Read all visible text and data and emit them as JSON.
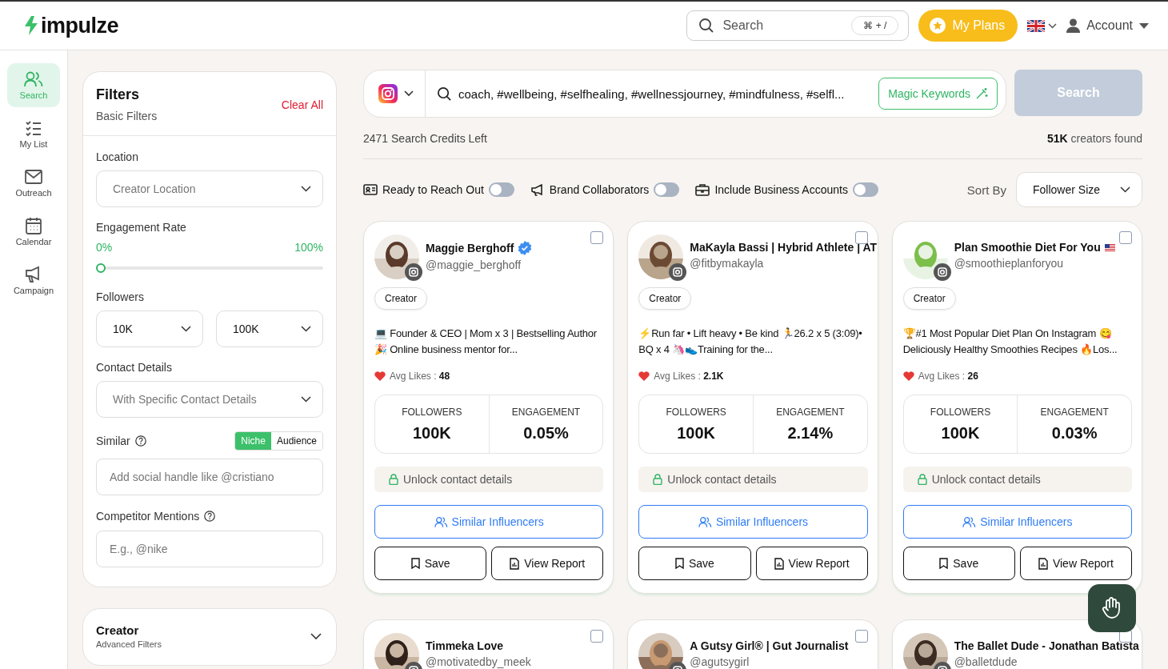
{
  "header": {
    "logo": "impulze",
    "search": {
      "placeholder": "Search",
      "shortcut": "⌘ + /"
    },
    "plans_button": "My Plans",
    "account": "Account"
  },
  "sidebar": {
    "items": [
      {
        "kind": "search",
        "label": "Search",
        "selected": true
      },
      {
        "kind": "list",
        "label": "My List",
        "selected": false
      },
      {
        "kind": "mail",
        "label": "Outreach",
        "selected": false
      },
      {
        "kind": "calendar",
        "label": "Calendar",
        "selected": false
      },
      {
        "kind": "campaign",
        "label": "Campaign",
        "selected": false
      }
    ]
  },
  "filters": {
    "title": "Filters",
    "subtitle": "Basic Filters",
    "clear": "Clear All",
    "location": {
      "label": "Location",
      "placeholder": "Creator Location"
    },
    "engagement": {
      "label": "Engagement Rate",
      "min": "0%",
      "max": "100%",
      "level": 0
    },
    "followers": {
      "label": "Followers",
      "from": "10K",
      "to": "100K"
    },
    "contact": {
      "label": "Contact Details",
      "placeholder": "With Specific Contact Details"
    },
    "similar": {
      "label": "Similar",
      "options": [
        {
          "label": "Niche",
          "selected": true
        },
        {
          "label": "Audience",
          "selected": false
        }
      ],
      "placeholder": "Add social handle like @cristiano"
    },
    "competitor": {
      "label": "Competitor Mentions",
      "placeholder": "E.g., @nike"
    },
    "advanced": {
      "title": "Creator",
      "subtitle": "Advanced Filters"
    }
  },
  "search_bar": {
    "query": "coach, #wellbeing, #selfhealing, #wellnessjourney, #mindfulness, #selfl...",
    "magic": "Magic Keywords",
    "button": "Search"
  },
  "credits": "2471 Search Credits Left",
  "found": {
    "count": "51K",
    "label": "creators found"
  },
  "toggles": [
    {
      "kind": "card",
      "label": "Ready to Reach Out",
      "on": false
    },
    {
      "kind": "megaphone",
      "label": "Brand Collaborators",
      "on": false
    },
    {
      "kind": "briefcase",
      "label": "Include Business Accounts",
      "on": false
    }
  ],
  "sort": {
    "label": "Sort By",
    "value": "Follower Size"
  },
  "cards": [
    {
      "name": "Maggie Berghoff",
      "verified": true,
      "us_flag": false,
      "handle": "@maggie_berghoff",
      "checked": false,
      "tag": "Creator",
      "bio": "💻 Founder & CEO | Mom x 3 | Bestselling Author 🎉 Online business mentor for...",
      "likes_label": "Avg Likes :",
      "likes": "48",
      "followers_label": "FOLLOWERS",
      "followers": "100K",
      "engagement_label": "ENGAGEMENT",
      "engagement": "0.05%",
      "unlock": "Unlock contact details",
      "similar": "Similar Influencers",
      "save": "Save",
      "report": "View Report"
    },
    {
      "name": "MaKayla Bassi | Hybrid Athlete | AT",
      "verified": false,
      "us_flag": false,
      "handle": "@fitbymakayla",
      "checked": false,
      "tag": "Creator",
      "bio": "⚡Run far • Lift heavy • Be kind 🏃26.2 x 5 (3:09)• BQ x 4 🦄👟Training for the...",
      "likes_label": "Avg Likes :",
      "likes": "2.1K",
      "followers_label": "FOLLOWERS",
      "followers": "100K",
      "engagement_label": "ENGAGEMENT",
      "engagement": "2.14%",
      "unlock": "Unlock contact details",
      "similar": "Similar Influencers",
      "save": "Save",
      "report": "View Report"
    },
    {
      "name": "Plan Smoothie Diet For You",
      "verified": false,
      "us_flag": true,
      "handle": "@smoothieplanforyou",
      "checked": false,
      "tag": "Creator",
      "bio": "🏆#1 Most Popular Diet Plan On Instagram 😋 Deliciously Healthy Smoothies Recipes 🔥Los...",
      "likes_label": "Avg Likes :",
      "likes": "26",
      "followers_label": "FOLLOWERS",
      "followers": "100K",
      "engagement_label": "ENGAGEMENT",
      "engagement": "0.03%",
      "unlock": "Unlock contact details",
      "similar": "Similar Influencers",
      "save": "Save",
      "report": "View Report"
    },
    {
      "name": "Timmeka Love",
      "verified": false,
      "us_flag": false,
      "handle": "@motivatedby_meek",
      "checked": false
    },
    {
      "name": "A Gutsy Girl® | Gut Journalist",
      "verified": false,
      "us_flag": false,
      "handle": "@agutsygirl",
      "checked": false
    },
    {
      "name": "The Ballet Dude - Jonathan Batista",
      "verified": false,
      "us_flag": false,
      "handle": "@balletdude",
      "checked": false
    }
  ]
}
